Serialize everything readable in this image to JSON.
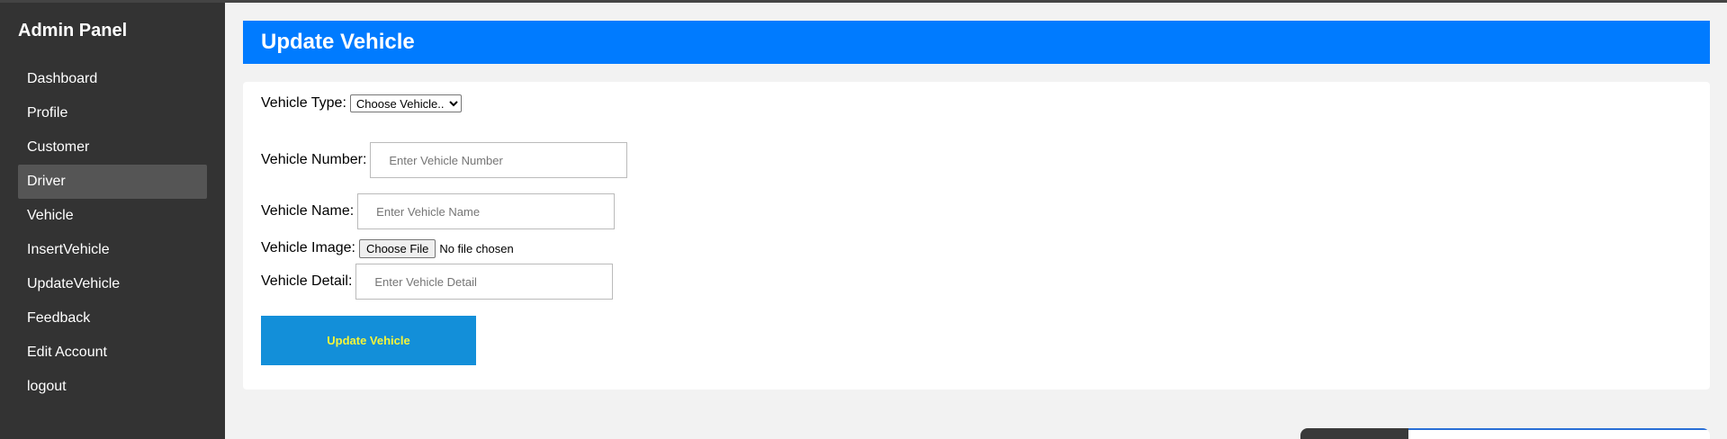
{
  "sidebar": {
    "title": "Admin Panel",
    "items": [
      {
        "label": "Dashboard"
      },
      {
        "label": "Profile"
      },
      {
        "label": "Customer"
      },
      {
        "label": "Driver"
      },
      {
        "label": "Vehicle"
      },
      {
        "label": "InsertVehicle"
      },
      {
        "label": "UpdateVehicle"
      },
      {
        "label": "Feedback"
      },
      {
        "label": "Edit Account"
      },
      {
        "label": "logout"
      }
    ],
    "active_item": "Driver"
  },
  "header": {
    "title": "Update Vehicle"
  },
  "form": {
    "vehicle_type": {
      "label": "Vehicle Type:",
      "selected": "Choose Vehicle.."
    },
    "vehicle_number": {
      "label": "Vehicle Number:",
      "placeholder": "Enter Vehicle Number",
      "value": ""
    },
    "vehicle_name": {
      "label": "Vehicle Name:",
      "placeholder": "Enter Vehicle Name",
      "value": ""
    },
    "vehicle_image": {
      "label": "Vehicle Image:",
      "button": "Choose File",
      "status": "No file chosen"
    },
    "vehicle_detail": {
      "label": "Vehicle Detail:",
      "placeholder": "Enter Vehicle Detail",
      "value": ""
    },
    "submit_label": "Update Vehicle"
  },
  "colors": {
    "sidebar_bg": "#333333",
    "sidebar_active": "#555555",
    "header_bg": "#007bff",
    "submit_bg": "#138fd9",
    "submit_text": "#f5f53a"
  }
}
